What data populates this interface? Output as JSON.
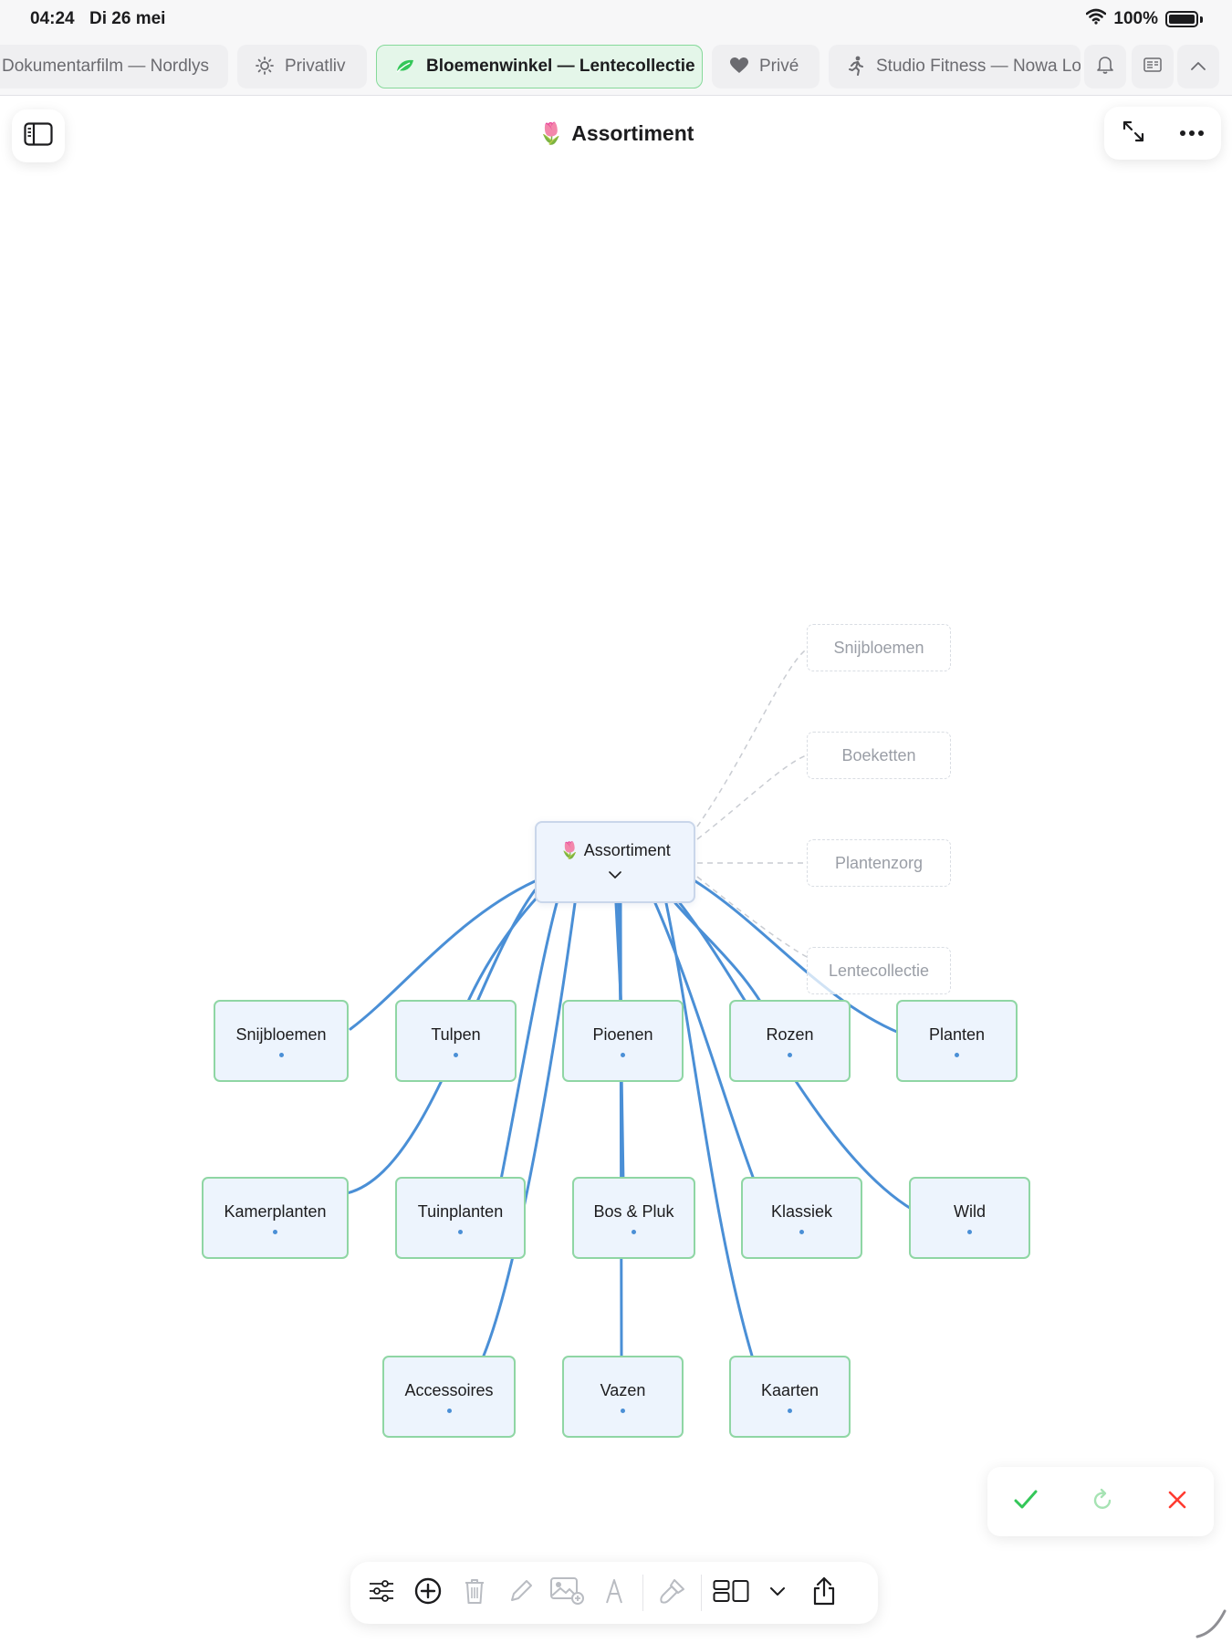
{
  "status": {
    "time": "04:24",
    "date": "Di 26 mei",
    "battery": "100%"
  },
  "tabs": [
    {
      "label": "Dokumentarfilm — Nordlys",
      "icon": "none",
      "active": false
    },
    {
      "label": "Privatliv",
      "icon": "sun-icon",
      "active": false
    },
    {
      "label": "Bloemenwinkel — Lentecollectie",
      "icon": "leaf-icon",
      "active": true
    },
    {
      "label": "Privé",
      "icon": "heart-icon",
      "active": false
    },
    {
      "label": "Studio Fitness — Nowa Lok",
      "icon": "running-icon",
      "active": false
    }
  ],
  "header": {
    "title": "Assortiment",
    "title_emoji": "🌷"
  },
  "mindmap": {
    "root": {
      "label": "Assortiment",
      "emoji": "🌷"
    },
    "children": [
      "Snijbloemen",
      "Tulpen",
      "Pioenen",
      "Rozen",
      "Planten",
      "Kamerplanten",
      "Tuinplanten",
      "Bos & Pluk",
      "Klassiek",
      "Wild",
      "Accessoires",
      "Vazen",
      "Kaarten"
    ],
    "suggestions": [
      "Snijbloemen",
      "Boeketten",
      "Plantenzorg",
      "Lentecollectie"
    ]
  },
  "colors": {
    "accent": "#4a8fd6",
    "node_border": "#8fd6a4",
    "node_fill": "#edf4fd",
    "confirm": "#34c759",
    "reject": "#ff3b30"
  }
}
